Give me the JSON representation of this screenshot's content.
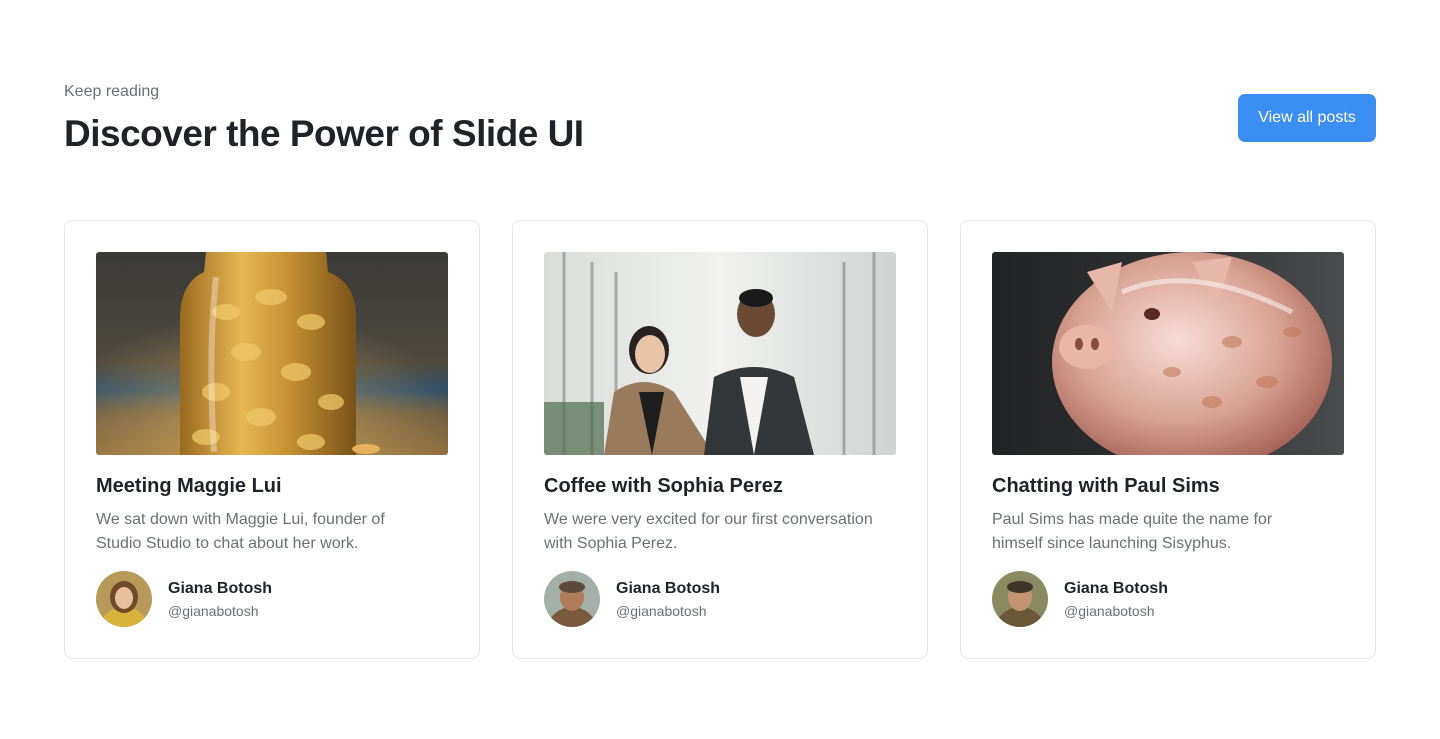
{
  "header": {
    "eyebrow": "Keep reading",
    "title": "Discover the Power of Slide UI",
    "view_all_label": "View all posts"
  },
  "colors": {
    "accent": "#3b8ff3",
    "text_primary": "#1f2328",
    "text_muted": "#6b6f75",
    "border": "#e6e7ea"
  },
  "posts": [
    {
      "title": "Meeting Maggie Lui",
      "description": "We sat down with Maggie Lui, founder of Studio Studio to chat about her work.",
      "image": "jar-of-gold-coins",
      "author": {
        "name": "Giana Botosh",
        "handle": "@gianabotosh",
        "avatar": "woman-portrait-avatar"
      }
    },
    {
      "title": "Coffee with Sophia Perez",
      "description": "We were very excited for our first conversation with Sophia Perez.",
      "image": "two-colleagues-in-office-hallway",
      "author": {
        "name": "Giana Botosh",
        "handle": "@gianabotosh",
        "avatar": "man-portrait-avatar"
      }
    },
    {
      "title": "Chatting with Paul Sims",
      "description": "Paul Sims has made quite the name for himself since launching Sisyphus.",
      "image": "glass-piggy-bank",
      "author": {
        "name": "Giana Botosh",
        "handle": "@gianabotosh",
        "avatar": "man-portrait-avatar"
      }
    }
  ]
}
